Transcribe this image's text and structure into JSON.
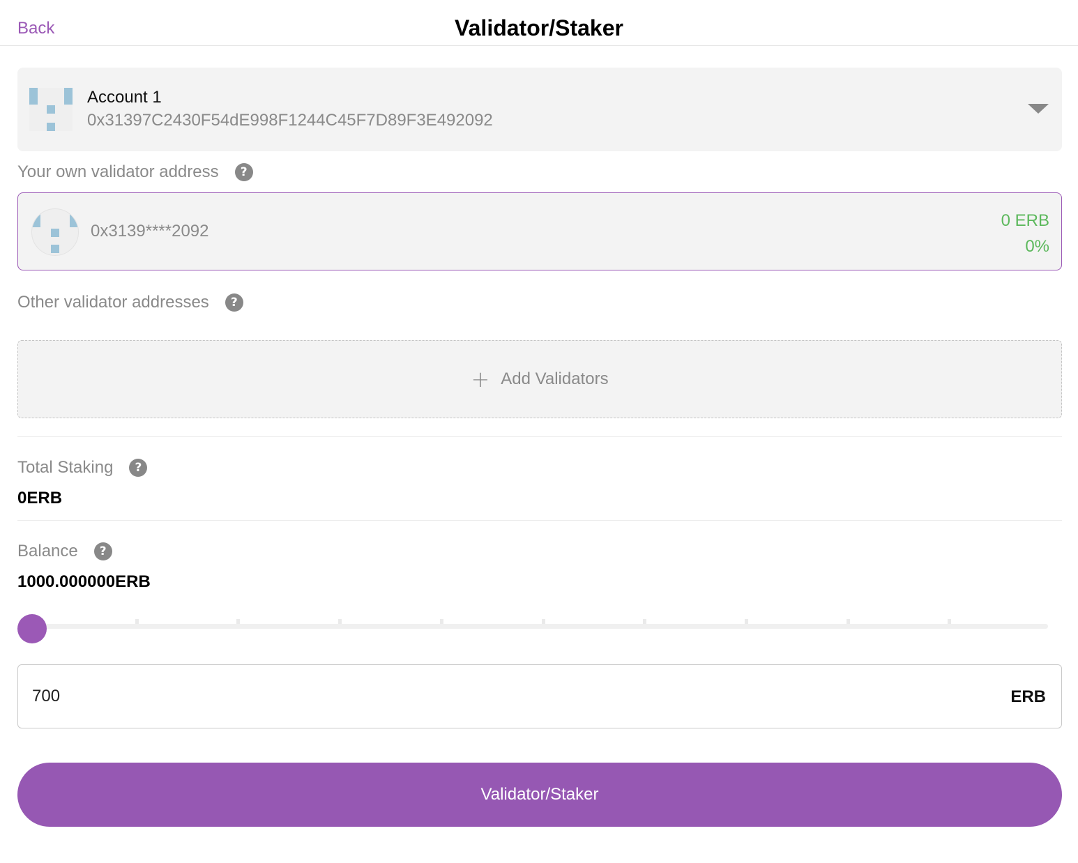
{
  "header": {
    "back_label": "Back",
    "title": "Validator/Staker"
  },
  "account": {
    "name": "Account 1",
    "address": "0x31397C2430F54dE998F1244C45F7D89F3E492092",
    "identicon_icon": "identicon-avatar",
    "dropdown_icon": "chevron-down-icon"
  },
  "own_validator": {
    "label": "Your own validator address",
    "address": "0x3139****2092",
    "amount": "0 ERB",
    "percent": "0%"
  },
  "other_validators": {
    "label": "Other validator addresses",
    "add_label": "Add Validators",
    "add_icon": "plus-icon"
  },
  "total_staking": {
    "label": "Total Staking",
    "value": "0ERB"
  },
  "balance": {
    "label": "Balance",
    "value": "1000.000000ERB"
  },
  "slider": {
    "level": 0,
    "tick_count": 9
  },
  "amount_input": {
    "value": "700",
    "unit": "ERB"
  },
  "submit_label": "Validator/Staker",
  "help_glyph": "?",
  "colors": {
    "accent": "#9b59b6",
    "button": "#9658b3",
    "positive": "#5cb85c",
    "muted_text": "#8a8a8a",
    "card_bg": "#f3f3f3"
  }
}
